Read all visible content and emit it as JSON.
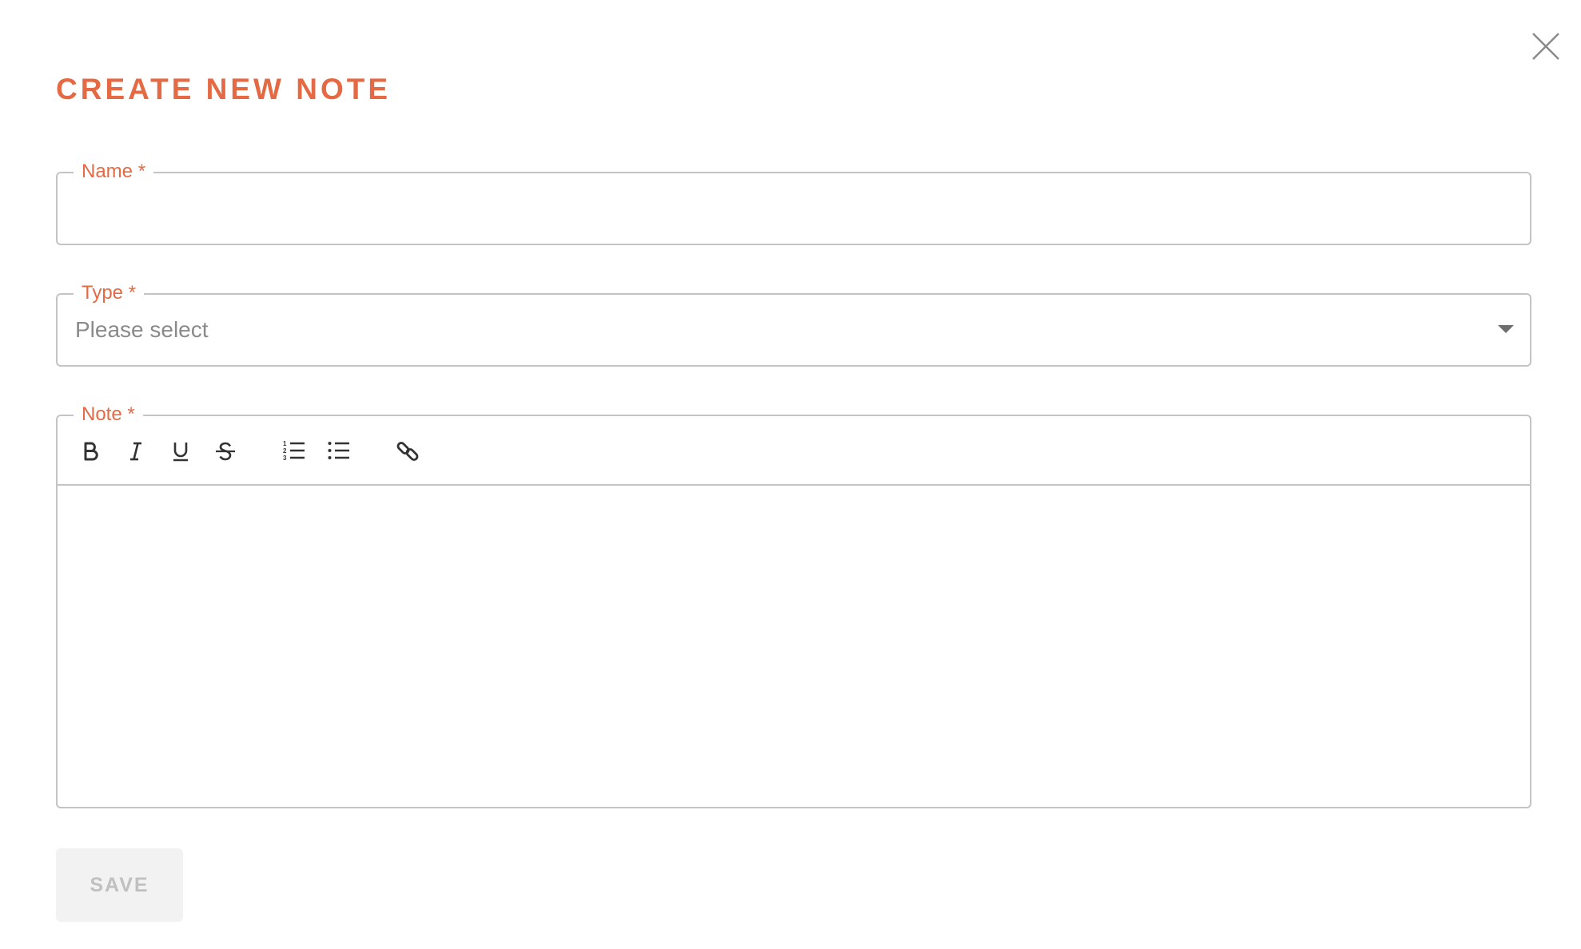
{
  "dialog": {
    "title": "CREATE NEW NOTE",
    "accent_color": "#e56a44",
    "close_icon": "close-icon"
  },
  "form": {
    "name": {
      "label": "Name *",
      "value": ""
    },
    "type": {
      "label": "Type *",
      "selected": "Please select"
    },
    "note": {
      "label": "Note *",
      "value": "",
      "toolbar": [
        {
          "name": "bold",
          "icon": "bold-icon"
        },
        {
          "name": "italic",
          "icon": "italic-icon"
        },
        {
          "name": "underline",
          "icon": "underline-icon"
        },
        {
          "name": "strikethrough",
          "icon": "strikethrough-icon"
        },
        {
          "name": "ordered-list",
          "icon": "ordered-list-icon"
        },
        {
          "name": "bullet-list",
          "icon": "bullet-list-icon"
        },
        {
          "name": "link",
          "icon": "link-icon"
        }
      ]
    }
  },
  "actions": {
    "save_label": "SAVE"
  }
}
